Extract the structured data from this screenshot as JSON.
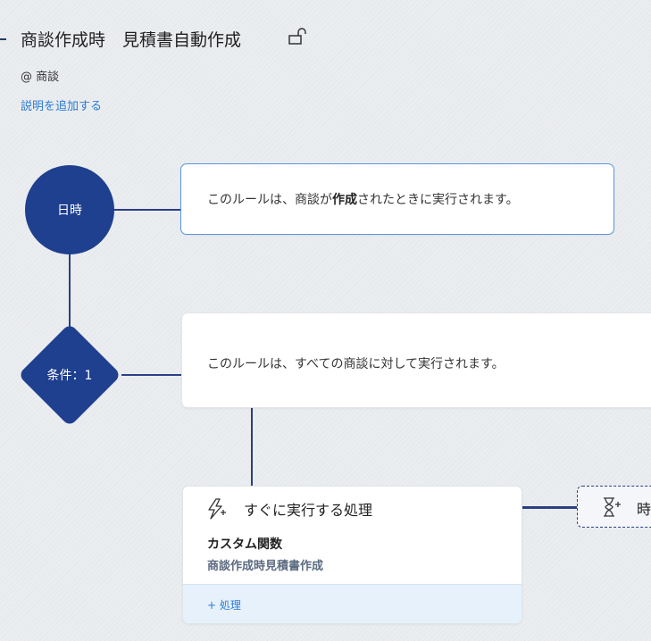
{
  "header": {
    "title": "商談作成時　見積書自動作成",
    "lock_icon": "unlock-icon",
    "module": "@ 商談",
    "add_description": "説明を追加する"
  },
  "trigger": {
    "node_label": "日時",
    "text_before": "このルールは、商談が",
    "text_bold": "作成",
    "text_after": "されたときに実行されます。"
  },
  "condition": {
    "node_label": "条件：1",
    "text": "このルールは、すべての商談に対して実行されます。"
  },
  "action": {
    "icon": "lightning-plus-icon",
    "title": "すぐに実行する処理",
    "function_label": "カスタム関数",
    "function_name": "商談作成時見積書作成",
    "add_action": "+ 処理"
  },
  "time_action": {
    "icon": "hourglass-plus-icon",
    "label": "時"
  },
  "colors": {
    "node": "#1f3f8f",
    "connector": "#2a3f86",
    "link": "#2b7bd4",
    "selected_border": "#5a96e3"
  }
}
